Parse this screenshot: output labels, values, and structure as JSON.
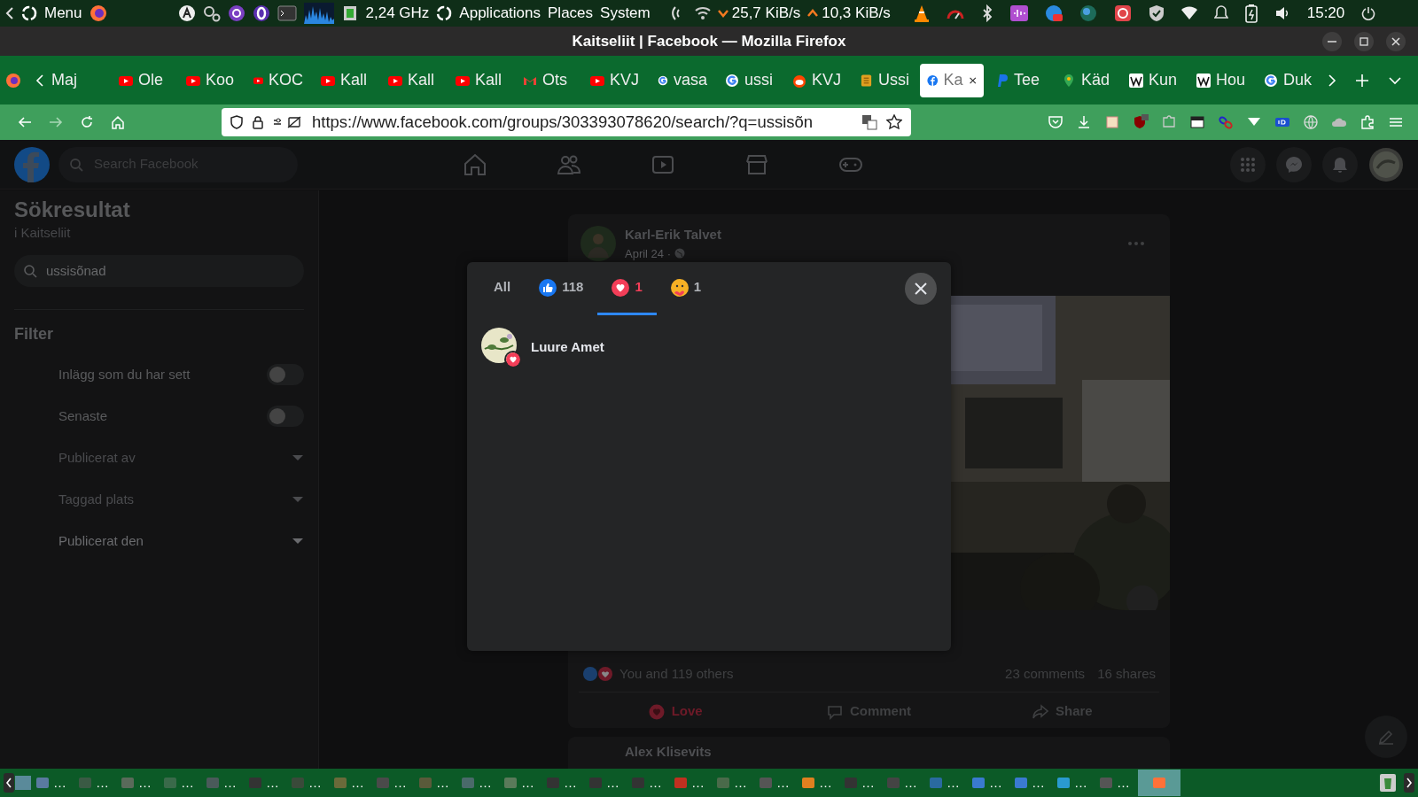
{
  "top_panel": {
    "menu_label": "Menu",
    "cpu_freq": "2,24 GHz",
    "menus": [
      "Applications",
      "Places",
      "System"
    ],
    "net_down": "25,7 KiB/s",
    "net_up": "10,3 KiB/s",
    "clock": "15:20"
  },
  "window": {
    "title": "Kaitseliit | Facebook — Mozilla Firefox"
  },
  "tabs": [
    {
      "label": "Maj",
      "kind": "none",
      "selected": false
    },
    {
      "label": "Ole",
      "kind": "video",
      "selected": false
    },
    {
      "label": "Koo",
      "kind": "video",
      "selected": false
    },
    {
      "label": "KOC",
      "kind": "video",
      "selected": false
    },
    {
      "label": "Kall",
      "kind": "video",
      "selected": false
    },
    {
      "label": "Kall",
      "kind": "video",
      "selected": false
    },
    {
      "label": "Kall",
      "kind": "video",
      "selected": false
    },
    {
      "label": "Ots",
      "kind": "mail",
      "selected": false
    },
    {
      "label": "KVJ",
      "kind": "video",
      "selected": false
    },
    {
      "label": "vasa",
      "kind": "search",
      "selected": false
    },
    {
      "label": "ussi",
      "kind": "search",
      "selected": false
    },
    {
      "label": "KVJ",
      "kind": "forum",
      "selected": false
    },
    {
      "label": "Ussi",
      "kind": "book",
      "selected": false
    },
    {
      "label": "Ka",
      "kind": "social",
      "selected": true
    },
    {
      "label": "Tee",
      "kind": "pay",
      "selected": false
    },
    {
      "label": "Käd",
      "kind": "map",
      "selected": false
    },
    {
      "label": "Kun",
      "kind": "wiki",
      "selected": false
    },
    {
      "label": "Hou",
      "kind": "wiki",
      "selected": false
    },
    {
      "label": "Duk",
      "kind": "search",
      "selected": false
    }
  ],
  "address_bar": {
    "url": "https://www.facebook.com/groups/303393078620/search/?q=ussisõn"
  },
  "facebook": {
    "search": {
      "placeholder": "Search Facebook"
    },
    "sidebar": {
      "title": "Sökresultat",
      "subtitle": "i Kaitseliit",
      "search": {
        "value": "ussisõnad"
      },
      "filter_heading": "Filter",
      "filters": [
        {
          "kind": "toggle",
          "label": "Inlägg som du har sett",
          "on": false
        },
        {
          "kind": "toggle",
          "label": "Senaste",
          "on": false
        },
        {
          "kind": "dropdown",
          "label": "Publicerat av",
          "disabled": true
        },
        {
          "kind": "dropdown",
          "label": "Taggad plats",
          "disabled": true
        },
        {
          "kind": "dropdown",
          "label": "Publicerat den",
          "disabled": false
        }
      ]
    },
    "post": {
      "author": "Karl-Erik Talvet",
      "date": "April 24 ·",
      "reactions_summary": "You and 119 others",
      "comments": "23 comments",
      "shares": "16 shares",
      "actions": [
        {
          "kind": "love",
          "label": "Love",
          "selected": true
        },
        {
          "kind": "comment",
          "label": "Comment",
          "selected": false
        },
        {
          "kind": "share",
          "label": "Share",
          "selected": false
        }
      ]
    },
    "next_post": {
      "author": "Alex Klisevits"
    },
    "reactions_dialog": {
      "tabs": [
        {
          "kind": "all",
          "label": "All",
          "selected": false
        },
        {
          "kind": "like",
          "label": "118",
          "selected": false
        },
        {
          "kind": "love",
          "label": "1",
          "selected": true
        },
        {
          "kind": "care",
          "label": "1",
          "selected": false
        }
      ],
      "people": [
        {
          "name": "Luure Amet",
          "kind": "love"
        }
      ]
    }
  },
  "taskbar": {
    "windows": [
      {
        "label": "…",
        "selected": false
      },
      {
        "label": "…",
        "selected": false
      },
      {
        "label": "…",
        "selected": false
      },
      {
        "label": "…",
        "selected": false
      },
      {
        "label": "…",
        "selected": false
      },
      {
        "label": "…",
        "selected": false
      },
      {
        "label": "…",
        "selected": false
      },
      {
        "label": "…",
        "selected": false
      },
      {
        "label": "…",
        "selected": false
      },
      {
        "label": "…",
        "selected": false
      },
      {
        "label": "…",
        "selected": false
      },
      {
        "label": "…",
        "selected": false
      },
      {
        "label": "…",
        "selected": false
      },
      {
        "label": "…",
        "selected": false
      },
      {
        "label": "…",
        "selected": false
      },
      {
        "label": "…",
        "selected": false
      },
      {
        "label": "…",
        "selected": false
      },
      {
        "label": "…",
        "selected": false
      },
      {
        "label": "…",
        "selected": false
      },
      {
        "label": "…",
        "selected": false
      },
      {
        "label": "…",
        "selected": false
      },
      {
        "label": "…",
        "selected": false
      },
      {
        "label": "…",
        "selected": false
      },
      {
        "label": "…",
        "selected": false
      },
      {
        "label": "…",
        "selected": false
      },
      {
        "label": "…",
        "selected": false
      },
      {
        "selected": true
      }
    ]
  }
}
